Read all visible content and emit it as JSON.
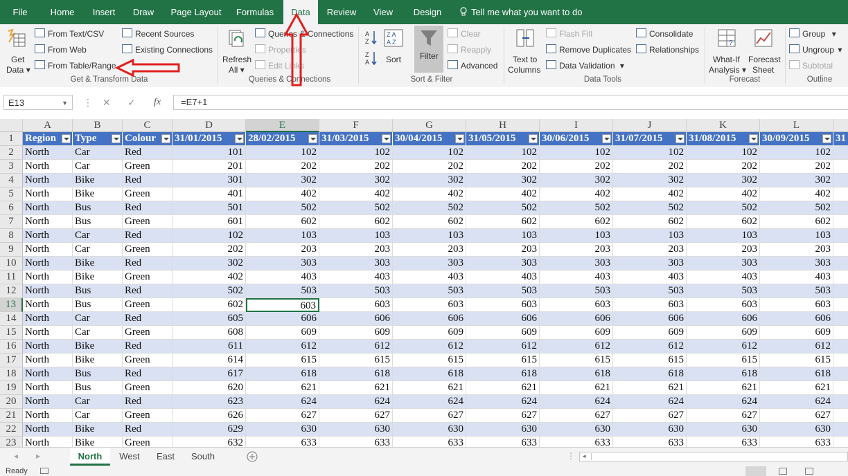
{
  "tabs": [
    {
      "label": "File",
      "active": false
    },
    {
      "label": "Home",
      "active": false
    },
    {
      "label": "Insert",
      "active": false
    },
    {
      "label": "Draw",
      "active": false
    },
    {
      "label": "Page Layout",
      "active": false
    },
    {
      "label": "Formulas",
      "active": false
    },
    {
      "label": "Data",
      "active": true
    },
    {
      "label": "Review",
      "active": false
    },
    {
      "label": "View",
      "active": false
    },
    {
      "label": "Design",
      "active": false
    }
  ],
  "tell_me": "Tell me what you want to do",
  "ribbon": {
    "get_data": {
      "line1": "Get",
      "line2": "Data"
    },
    "from_text_csv": "From Text/CSV",
    "from_web": "From Web",
    "from_table_range": "From Table/Range",
    "recent_sources": "Recent Sources",
    "existing_connections": "Existing Connections",
    "group_get_transform": "Get & Transform Data",
    "refresh_all": {
      "line1": "Refresh",
      "line2": "All"
    },
    "queries_connections": "Queries & Connections",
    "properties": "Properties",
    "edit_links": "Edit Links",
    "group_queries": "Queries & Connections",
    "sort": "Sort",
    "filter": "Filter",
    "clear": "Clear",
    "reapply": "Reapply",
    "advanced": "Advanced",
    "group_sort_filter": "Sort & Filter",
    "text_to_columns": {
      "line1": "Text to",
      "line2": "Columns"
    },
    "flash_fill": "Flash Fill",
    "remove_duplicates": "Remove Duplicates",
    "data_validation": "Data Validation",
    "consolidate": "Consolidate",
    "relationships": "Relationships",
    "group_data_tools": "Data Tools",
    "what_if": {
      "line1": "What-If",
      "line2": "Analysis"
    },
    "forecast_sheet": {
      "line1": "Forecast",
      "line2": "Sheet"
    },
    "group_forecast": "Forecast",
    "group": "Group",
    "ungroup": "Ungroup",
    "subtotal": "Subtotal",
    "group_outline": "Outline"
  },
  "formula_bar": {
    "name_box": "E13",
    "formula": "=E7+1",
    "fx": "fx"
  },
  "columns": [
    "A",
    "B",
    "C",
    "D",
    "E",
    "F",
    "G",
    "H",
    "I",
    "J",
    "K",
    "L"
  ],
  "selected_column": "E",
  "selected_row": 13,
  "headers": [
    "Region",
    "Type",
    "Colour",
    "31/01/2015",
    "28/02/2015",
    "31/03/2015",
    "30/04/2015",
    "31/05/2015",
    "30/06/2015",
    "31/07/2015",
    "31/08/2015",
    "30/09/2015",
    "31"
  ],
  "rows": [
    {
      "n": 2,
      "region": "North",
      "type": "Car",
      "colour": "Red",
      "d": 101,
      "v": 102
    },
    {
      "n": 3,
      "region": "North",
      "type": "Car",
      "colour": "Green",
      "d": 201,
      "v": 202
    },
    {
      "n": 4,
      "region": "North",
      "type": "Bike",
      "colour": "Red",
      "d": 301,
      "v": 302
    },
    {
      "n": 5,
      "region": "North",
      "type": "Bike",
      "colour": "Green",
      "d": 401,
      "v": 402
    },
    {
      "n": 6,
      "region": "North",
      "type": "Bus",
      "colour": "Red",
      "d": 501,
      "v": 502
    },
    {
      "n": 7,
      "region": "North",
      "type": "Bus",
      "colour": "Green",
      "d": 601,
      "v": 602
    },
    {
      "n": 8,
      "region": "North",
      "type": "Car",
      "colour": "Red",
      "d": 102,
      "v": 103
    },
    {
      "n": 9,
      "region": "North",
      "type": "Car",
      "colour": "Green",
      "d": 202,
      "v": 203
    },
    {
      "n": 10,
      "region": "North",
      "type": "Bike",
      "colour": "Red",
      "d": 302,
      "v": 303
    },
    {
      "n": 11,
      "region": "North",
      "type": "Bike",
      "colour": "Green",
      "d": 402,
      "v": 403
    },
    {
      "n": 12,
      "region": "North",
      "type": "Bus",
      "colour": "Red",
      "d": 502,
      "v": 503
    },
    {
      "n": 13,
      "region": "North",
      "type": "Bus",
      "colour": "Green",
      "d": 602,
      "v": 603
    },
    {
      "n": 14,
      "region": "North",
      "type": "Car",
      "colour": "Red",
      "d": 605,
      "v": 606
    },
    {
      "n": 15,
      "region": "North",
      "type": "Car",
      "colour": "Green",
      "d": 608,
      "v": 609
    },
    {
      "n": 16,
      "region": "North",
      "type": "Bike",
      "colour": "Red",
      "d": 611,
      "v": 612
    },
    {
      "n": 17,
      "region": "North",
      "type": "Bike",
      "colour": "Green",
      "d": 614,
      "v": 615
    },
    {
      "n": 18,
      "region": "North",
      "type": "Bus",
      "colour": "Red",
      "d": 617,
      "v": 618
    },
    {
      "n": 19,
      "region": "North",
      "type": "Bus",
      "colour": "Green",
      "d": 620,
      "v": 621
    },
    {
      "n": 20,
      "region": "North",
      "type": "Car",
      "colour": "Red",
      "d": 623,
      "v": 624
    },
    {
      "n": 21,
      "region": "North",
      "type": "Car",
      "colour": "Green",
      "d": 626,
      "v": 627
    },
    {
      "n": 22,
      "region": "North",
      "type": "Bike",
      "colour": "Red",
      "d": 629,
      "v": 630
    },
    {
      "n": 23,
      "region": "North",
      "type": "Bike",
      "colour": "Green",
      "d": 632,
      "v": 633
    }
  ],
  "sheets": [
    {
      "label": "North",
      "active": true
    },
    {
      "label": "West",
      "active": false
    },
    {
      "label": "East",
      "active": false
    },
    {
      "label": "South",
      "active": false
    }
  ],
  "status": {
    "ready": "Ready"
  },
  "colors": {
    "excel_green": "#217346",
    "table_header": "#4472c4",
    "band": "#d9e1f2",
    "annotation": "#e02020"
  },
  "icons": [
    "lightbulb-icon",
    "get-data-icon",
    "refresh-icon",
    "sort-az-icon",
    "sort-za-icon",
    "filter-icon",
    "text-to-columns-icon",
    "what-if-icon",
    "forecast-icon",
    "fx-icon",
    "add-sheet-icon"
  ]
}
